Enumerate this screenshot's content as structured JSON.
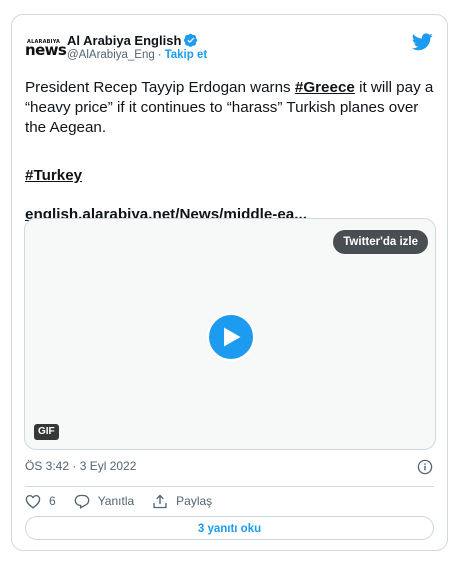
{
  "account": {
    "logo_small": "ALARABIYA",
    "logo_big": "news",
    "display_name": "Al Arabiya English",
    "handle": "@AlArabiya_Eng",
    "separator": "·",
    "follow_label": "Takip et"
  },
  "tweet": {
    "text_before_tag": "President Recep Tayyip Erdogan warns ",
    "inline_tag": "#Greece",
    "text_after_tag": " it will pay a “heavy price” if it continues to “harass” Turkish planes over the Aegean.",
    "hashtag": "#Turkey",
    "link": "english.alarabiya.net/News/middle-ea..."
  },
  "media": {
    "watch_label": "Twitter'da izle",
    "badge": "GIF"
  },
  "meta": {
    "timestamp": "ÖS 3:42 · 3 Eyl 2022"
  },
  "actions": {
    "like_count": "6",
    "reply_label": "Yanıtla",
    "share_label": "Paylaş"
  },
  "replies_button": "3 yanıtı oku",
  "colors": {
    "accent": "#1d9bf0",
    "text": "#0f1419",
    "muted": "#536471",
    "border": "#cfd9de"
  },
  "icons": [
    "verified-icon",
    "twitter-bird-icon",
    "play-icon",
    "info-icon",
    "heart-icon",
    "reply-icon",
    "share-icon"
  ]
}
